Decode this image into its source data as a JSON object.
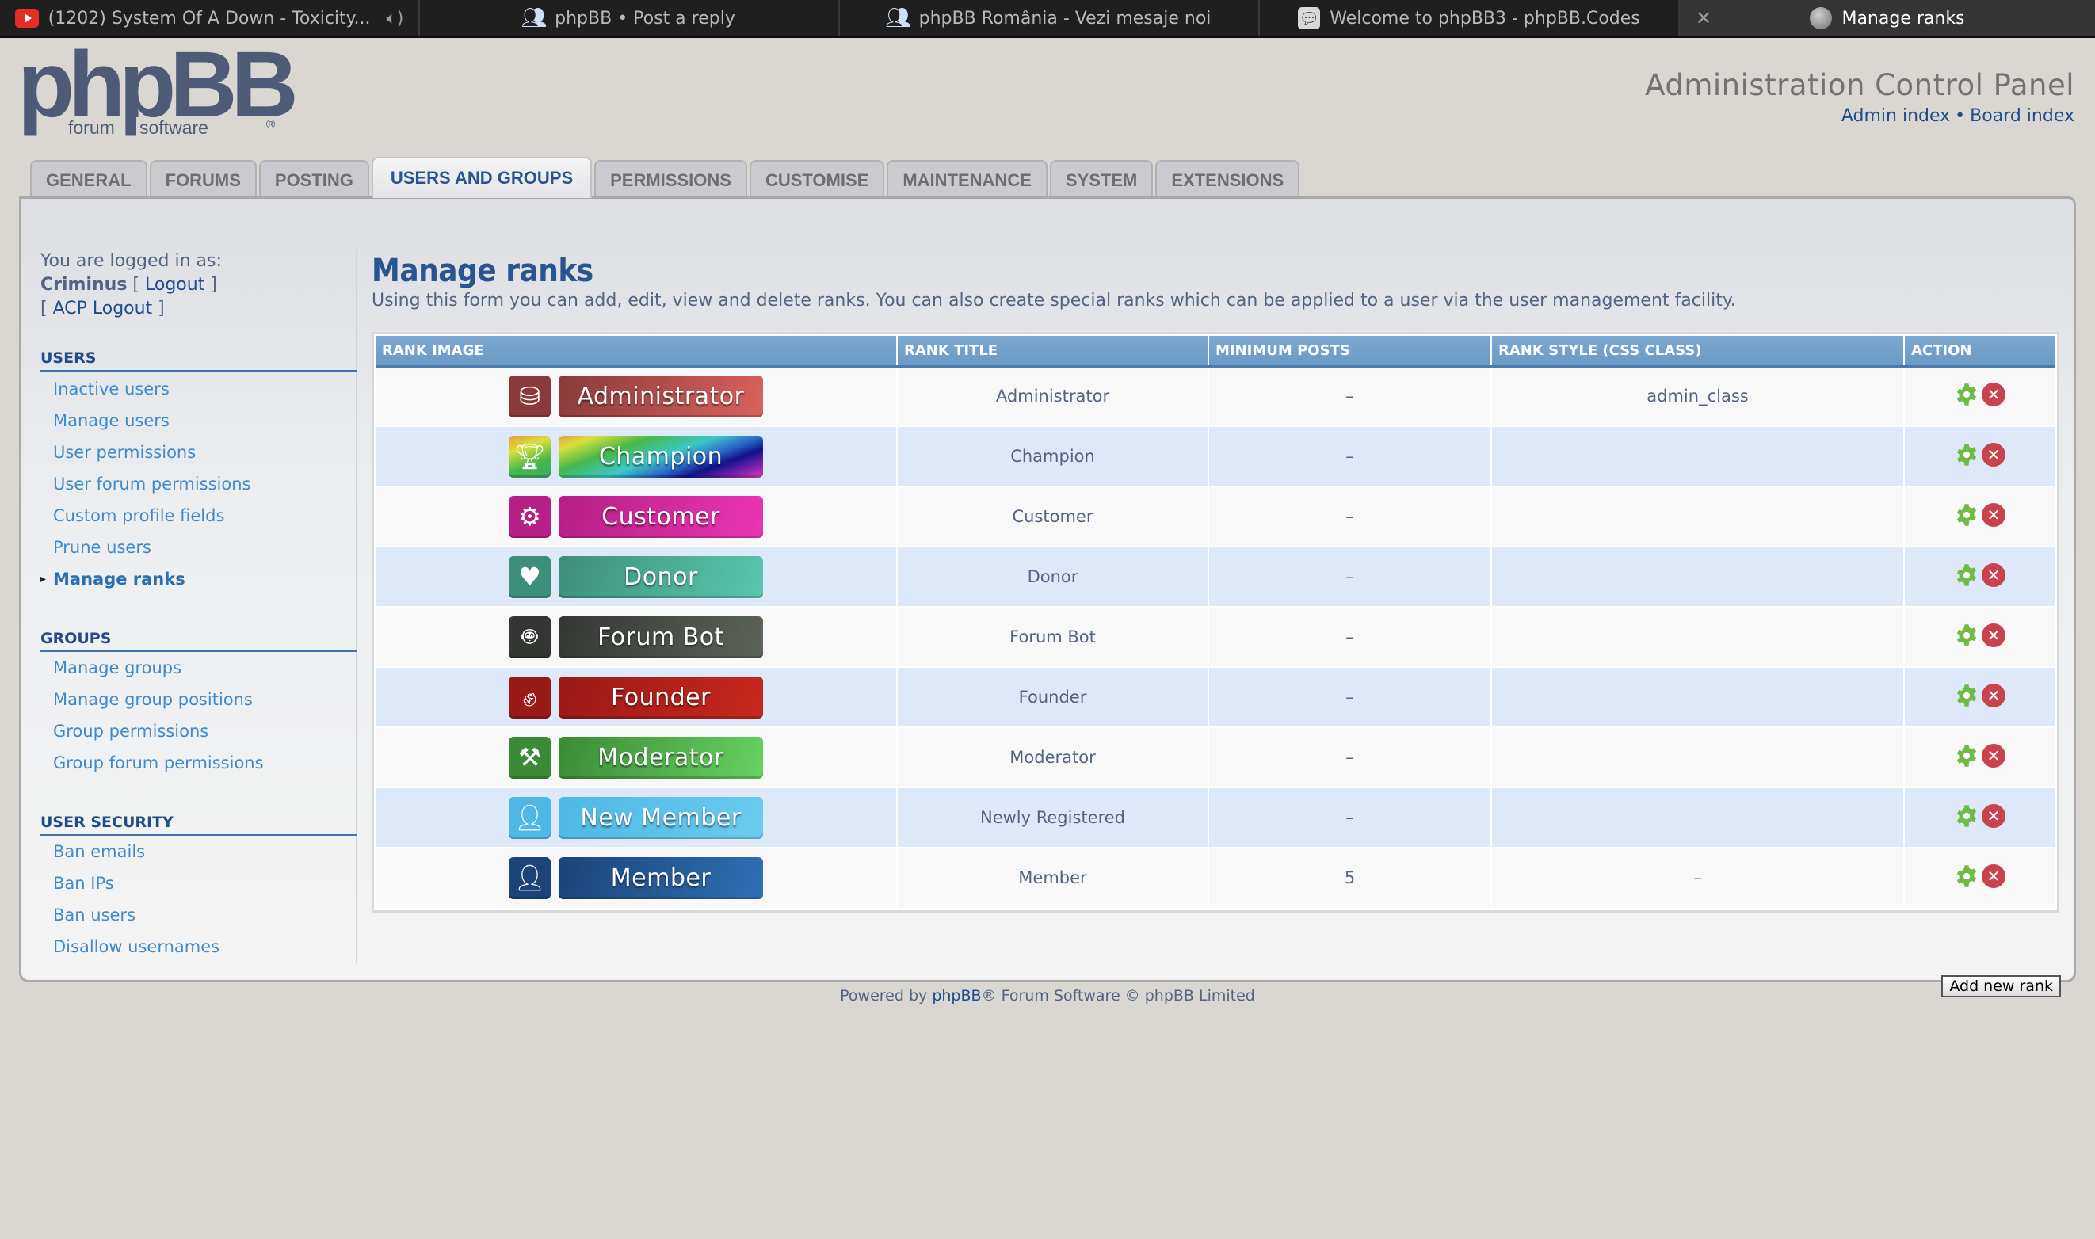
{
  "browser": {
    "tabs": [
      {
        "title": "(1202) System Of A Down - Toxicity...",
        "icon": "youtube-icon",
        "audio": true,
        "active": false
      },
      {
        "title": "phpBB • Post a reply",
        "icon": "users-icon",
        "active": false
      },
      {
        "title": "phpBB România - Vezi mesaje noi",
        "icon": "users-icon",
        "active": false
      },
      {
        "title": "Welcome to phpBB3 - phpBB.Codes",
        "icon": "chat-icon",
        "active": false
      },
      {
        "title": "Manage ranks",
        "icon": "globe-icon",
        "active": true,
        "close": "✕"
      }
    ]
  },
  "header": {
    "logo_main": "phpBB",
    "logo_sub1": "forum",
    "logo_sub2": "software",
    "logo_reg": "®",
    "title": "Administration Control Panel",
    "links": {
      "admin_index": "Admin index",
      "separator": "•",
      "board_index": "Board index"
    }
  },
  "nav_tabs": [
    {
      "label": "GENERAL",
      "active": false
    },
    {
      "label": "FORUMS",
      "active": false
    },
    {
      "label": "POSTING",
      "active": false
    },
    {
      "label": "USERS AND GROUPS",
      "active": true
    },
    {
      "label": "PERMISSIONS",
      "active": false
    },
    {
      "label": "CUSTOMISE",
      "active": false
    },
    {
      "label": "MAINTENANCE",
      "active": false
    },
    {
      "label": "SYSTEM",
      "active": false
    },
    {
      "label": "EXTENSIONS",
      "active": false
    }
  ],
  "sidebar": {
    "logged_in_label": "You are logged in as:",
    "username": "Criminus",
    "logout": "Logout",
    "acp_logout": "ACP Logout",
    "sections": [
      {
        "title": "USERS",
        "items": [
          {
            "label": "Inactive users"
          },
          {
            "label": "Manage users"
          },
          {
            "label": "User permissions"
          },
          {
            "label": "User forum permissions"
          },
          {
            "label": "Custom profile fields"
          },
          {
            "label": "Prune users"
          },
          {
            "label": "Manage ranks",
            "current": true
          }
        ]
      },
      {
        "title": "GROUPS",
        "items": [
          {
            "label": "Manage groups"
          },
          {
            "label": "Manage group positions"
          },
          {
            "label": "Group permissions"
          },
          {
            "label": "Group forum permissions"
          }
        ]
      },
      {
        "title": "USER SECURITY",
        "items": [
          {
            "label": "Ban emails"
          },
          {
            "label": "Ban IPs"
          },
          {
            "label": "Ban users"
          },
          {
            "label": "Disallow usernames"
          }
        ]
      }
    ]
  },
  "main": {
    "title": "Manage ranks",
    "description": "Using this form you can add, edit, view and delete ranks. You can also create special ranks which can be applied to a user via the user management facility.",
    "table": {
      "columns": [
        "RANK IMAGE",
        "RANK TITLE",
        "MINIMUM POSTS",
        "RANK STYLE (CSS CLASS)",
        "ACTION"
      ],
      "rows": [
        {
          "badge": "Administrator",
          "icon": "database-gear-icon",
          "colors": [
            "#8a3a3a",
            "#d9625f"
          ],
          "title": "Administrator",
          "min_posts": "–",
          "style": "admin_class"
        },
        {
          "badge": "Champion",
          "icon": "trophy-icon",
          "colors": [
            "rainbow"
          ],
          "title": "Champion",
          "min_posts": "–",
          "style": ""
        },
        {
          "badge": "Customer",
          "icon": "hand-gear-icon",
          "colors": [
            "#b51f86",
            "#ea36b3"
          ],
          "title": "Customer",
          "min_posts": "–",
          "style": ""
        },
        {
          "badge": "Donor",
          "icon": "hand-heart-icon",
          "colors": [
            "#3d8f7b",
            "#59c7ad"
          ],
          "title": "Donor",
          "min_posts": "–",
          "style": ""
        },
        {
          "badge": "Forum Bot",
          "icon": "robot-icon",
          "colors": [
            "#343634",
            "#5d6459"
          ],
          "title": "Forum Bot",
          "min_posts": "–",
          "style": ""
        },
        {
          "badge": "Founder",
          "icon": "fist-icon",
          "colors": [
            "#9a1a15",
            "#c8281e"
          ],
          "title": "Founder",
          "min_posts": "–",
          "style": ""
        },
        {
          "badge": "Moderator",
          "icon": "gavel-icon",
          "colors": [
            "#3b8a36",
            "#66d35f"
          ],
          "title": "Moderator",
          "min_posts": "–",
          "style": ""
        },
        {
          "badge": "New Member",
          "icon": "user-icon",
          "colors": [
            "#4eb7e6",
            "#6ccbee"
          ],
          "title": "Newly Registered",
          "min_posts": "–",
          "style": ""
        },
        {
          "badge": "Member",
          "icon": "user-icon",
          "colors": [
            "#1b4478",
            "#2f70b6"
          ],
          "title": "Member",
          "min_posts": "5",
          "style": "–"
        }
      ],
      "actions": {
        "edit_icon": "gear-icon",
        "delete_icon": "delete-icon",
        "delete_glyph": "✕"
      }
    },
    "add_button": "Add new rank"
  },
  "footer": {
    "prefix": "Powered by",
    "link": "phpBB",
    "suffix": "® Forum Software © phpBB Limited"
  }
}
